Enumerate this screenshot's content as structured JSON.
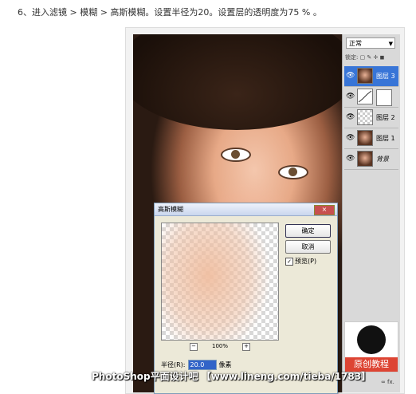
{
  "caption": "6、进入滤镜 > 模糊 > 高斯模糊。设置半径为20。设置层的透明度为75 % 。",
  "layers_panel": {
    "blend_mode": "正常",
    "lock_label": "锁定:",
    "layers": [
      {
        "name": "图层 3",
        "selected": true
      },
      {
        "name": "",
        "selected": false
      },
      {
        "name": "图层 2",
        "selected": false
      },
      {
        "name": "图层 1",
        "selected": false
      },
      {
        "name": "背景",
        "selected": false
      }
    ]
  },
  "dialog": {
    "title": "高斯模糊",
    "close_label": "×",
    "ok_label": "确定",
    "cancel_label": "取消",
    "preview_label": "预览(P)",
    "preview_checked": true,
    "zoom_minus": "−",
    "zoom_value": "100%",
    "zoom_plus": "+",
    "radius_label": "半径(R):",
    "radius_value": "20.0",
    "unit_label": "像素"
  },
  "logo_text": "原创教程",
  "watermark": "PhotoShop平面设计吧 【www.lineng.com/tieba/1783】"
}
